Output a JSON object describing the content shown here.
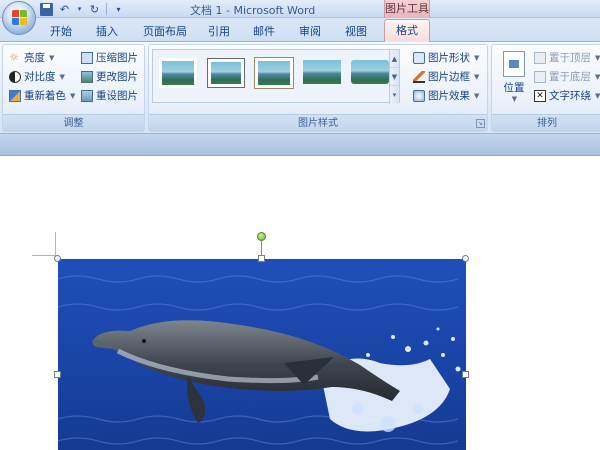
{
  "window": {
    "title": "文档 1 - Microsoft Word",
    "context_tab_group": "图片工具"
  },
  "tabs": [
    {
      "label": "开始"
    },
    {
      "label": "插入"
    },
    {
      "label": "页面布局"
    },
    {
      "label": "引用"
    },
    {
      "label": "邮件"
    },
    {
      "label": "审阅"
    },
    {
      "label": "视图"
    },
    {
      "label": "格式",
      "active": true
    }
  ],
  "ribbon": {
    "adjust": {
      "label": "调整",
      "brightness": "亮度",
      "contrast": "对比度",
      "recolor": "重新着色",
      "compress": "压缩图片",
      "change": "更改图片",
      "reset": "重设图片"
    },
    "styles": {
      "label": "图片样式",
      "shape": "图片形状",
      "border": "图片边框",
      "effects": "图片效果",
      "gallery_count": 5
    },
    "arrange": {
      "label": "排列",
      "position": "位置",
      "bring_front": "置于顶层",
      "send_back": "置于底层",
      "text_wrap": "文字环绕"
    }
  },
  "colors": {
    "ribbon_text": "#15428b",
    "context_tab": "#eab3ba",
    "rotate_handle": "#5fb32c",
    "selection_handle": "#6f7f92"
  },
  "document": {
    "image": {
      "description_icon": "dolphin-image",
      "selected": true
    }
  }
}
